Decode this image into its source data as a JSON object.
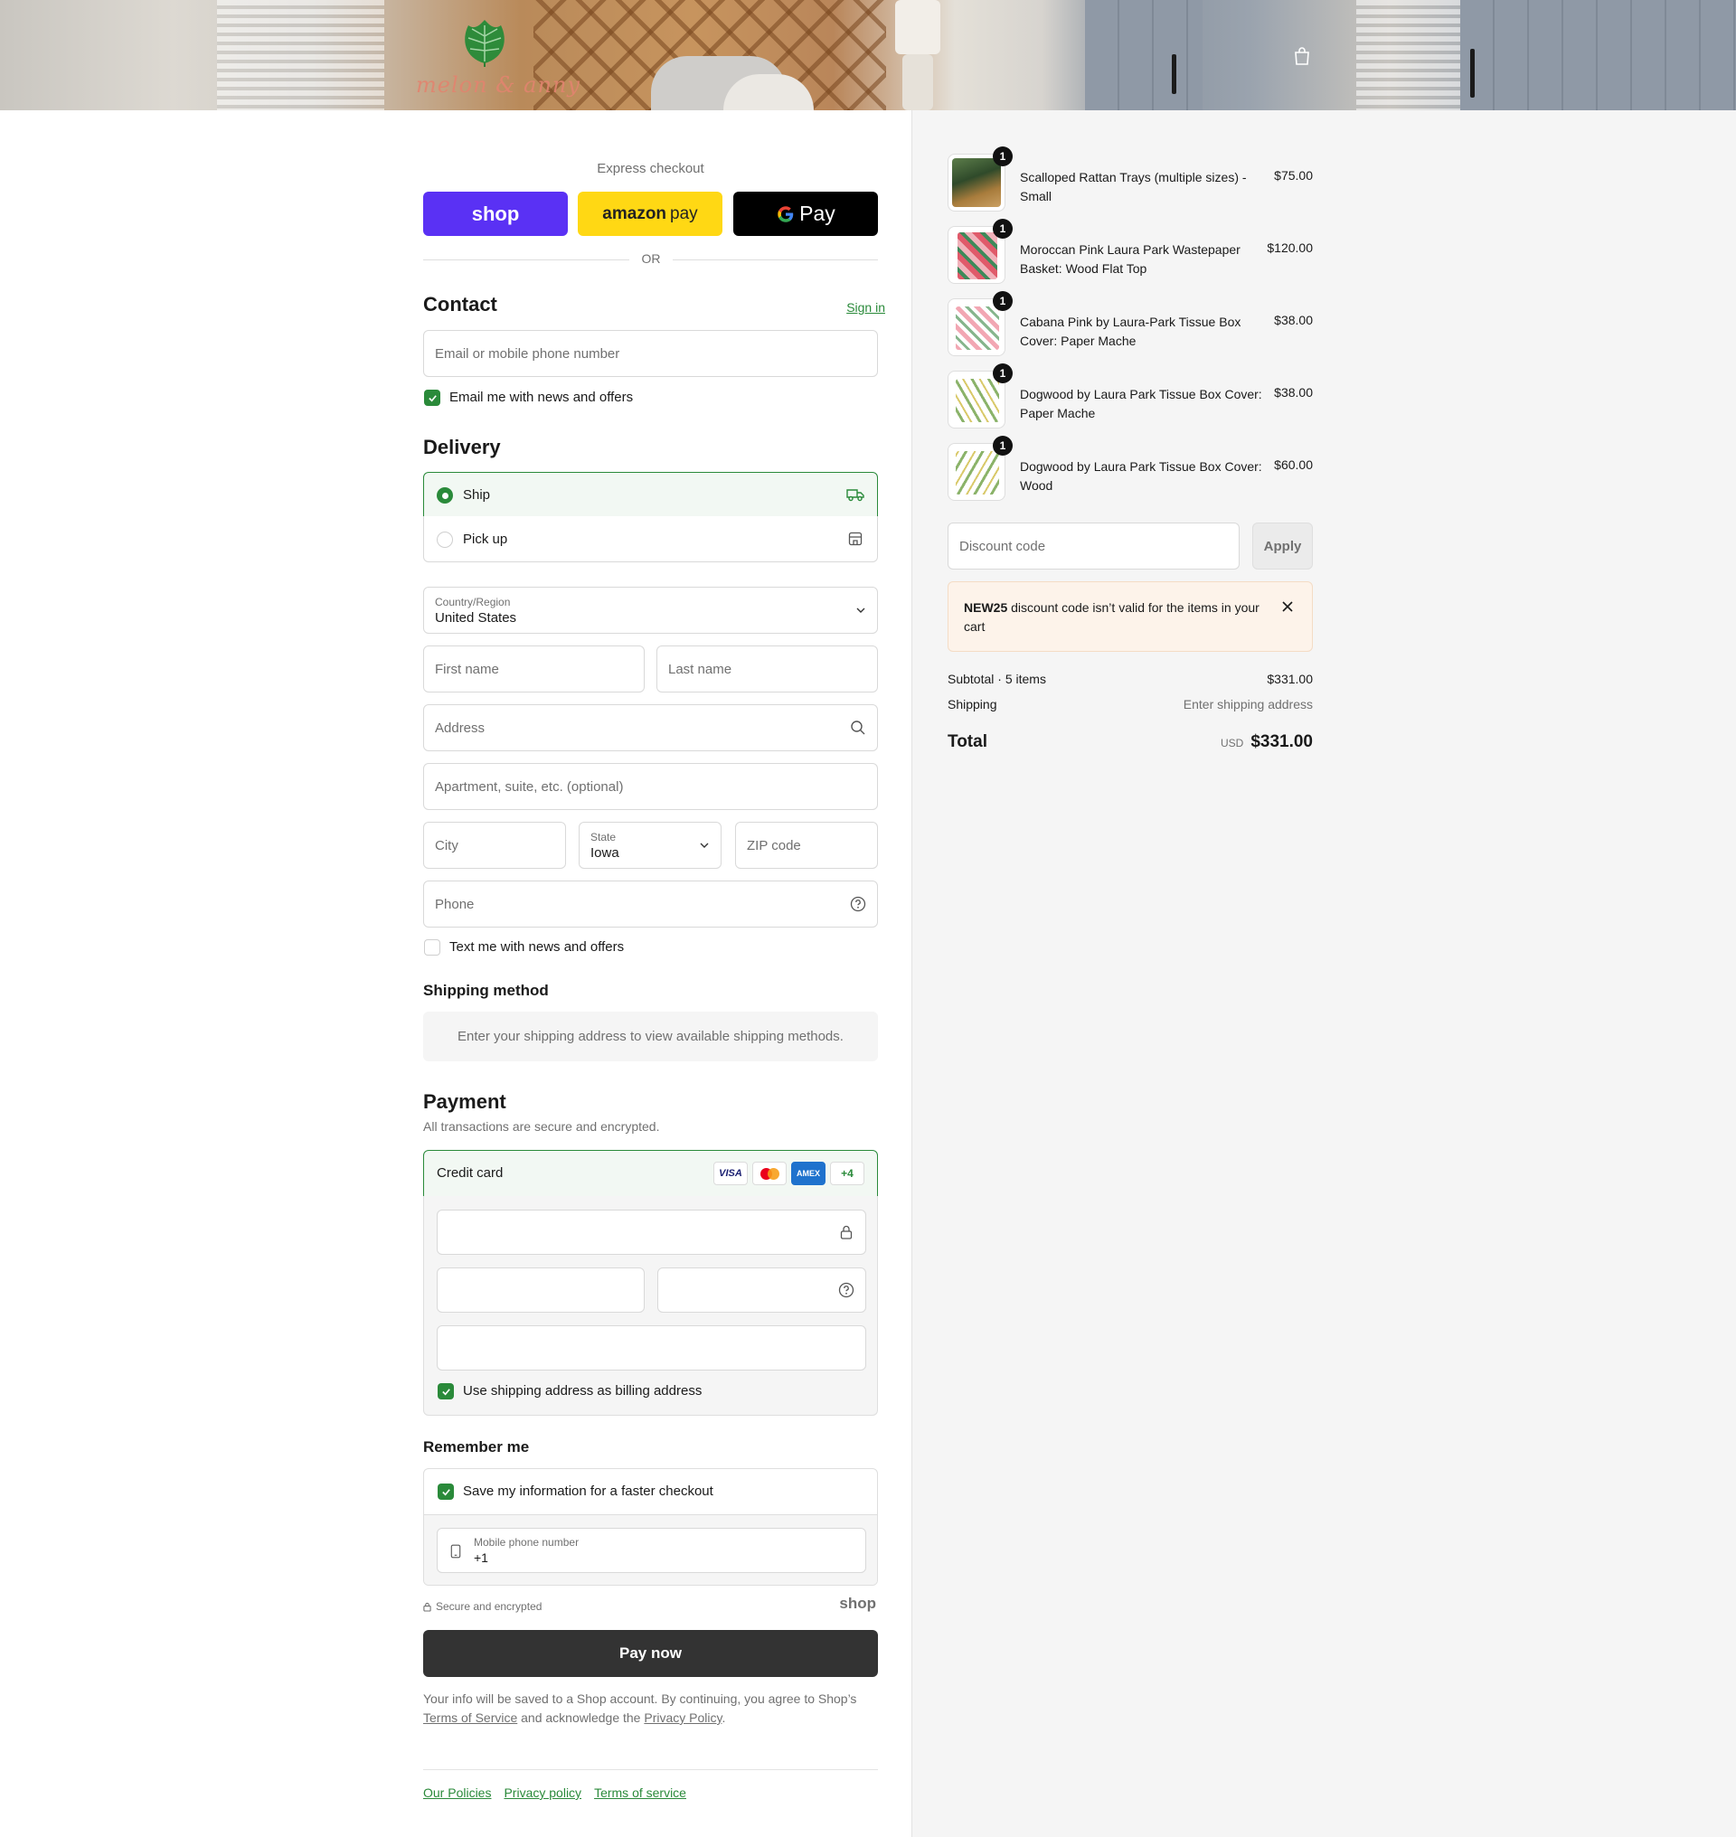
{
  "header": {
    "logo_text": "melon & anny",
    "cart_icon": "shopping-bag-icon"
  },
  "express": {
    "title": "Express checkout",
    "shop_label": "shop",
    "amazon_label_1": "amazon",
    "amazon_label_2": "pay",
    "gpay_label": "Pay",
    "or": "OR"
  },
  "contact": {
    "title": "Contact",
    "sign_in": "Sign in",
    "email_placeholder": "Email or mobile phone number",
    "news_label": "Email me with news and offers",
    "news_checked": true
  },
  "delivery": {
    "title": "Delivery",
    "options": [
      {
        "label": "Ship",
        "selected": true,
        "icon": "truck-icon"
      },
      {
        "label": "Pick up",
        "selected": false,
        "icon": "store-icon"
      }
    ],
    "country_label": "Country/Region",
    "country_value": "United States",
    "first_name": "First name",
    "last_name": "Last name",
    "address": "Address",
    "apartment": "Apartment, suite, etc. (optional)",
    "city": "City",
    "state_label": "State",
    "state_value": "Iowa",
    "zip": "ZIP code",
    "phone": "Phone",
    "text_label": "Text me with news and offers",
    "text_checked": false
  },
  "shipping_method": {
    "title": "Shipping method",
    "message": "Enter your shipping address to view available shipping methods."
  },
  "payment": {
    "title": "Payment",
    "subtitle": "All transactions are secure and encrypted.",
    "method_label": "Credit card",
    "cards": [
      "VISA",
      "mastercard",
      "AMEX",
      "+4"
    ],
    "billing_label": "Use shipping address as billing address",
    "billing_checked": true
  },
  "remember": {
    "title": "Remember me",
    "save_label": "Save my information for a faster checkout",
    "save_checked": true,
    "mobile_label": "Mobile phone number",
    "mobile_value": "+1",
    "secure": "Secure and encrypted",
    "shop_brand": "shop"
  },
  "pay_button": "Pay now",
  "legal": {
    "text_1": "Your info will be saved to a Shop account. By continuing, you agree to Shop’s",
    "terms": "Terms of Service",
    "text_2": "and acknowledge the",
    "privacy": "Privacy Policy",
    "text_3": "."
  },
  "footer_links": [
    "Our Policies",
    "Privacy policy",
    "Terms of service"
  ],
  "summary": {
    "items": [
      {
        "name": "Scalloped Rattan Trays (multiple sizes) - Small",
        "price": "$75.00",
        "qty": "1"
      },
      {
        "name": "Moroccan Pink Laura Park Wastepaper Basket: Wood Flat Top",
        "price": "$120.00",
        "qty": "1"
      },
      {
        "name": "Cabana Pink by Laura-Park Tissue Box Cover: Paper Mache",
        "price": "$38.00",
        "qty": "1"
      },
      {
        "name": "Dogwood by Laura Park Tissue Box Cover: Paper Mache",
        "price": "$38.00",
        "qty": "1"
      },
      {
        "name": "Dogwood by Laura Park Tissue Box Cover: Wood",
        "price": "$60.00",
        "qty": "1"
      }
    ],
    "discount_placeholder": "Discount code",
    "apply": "Apply",
    "warning_code": "NEW25",
    "warning_text": "discount code isn’t valid for the items in your cart",
    "subtotal_label": "Subtotal · 5 items",
    "subtotal_value": "$331.00",
    "shipping_label": "Shipping",
    "shipping_value": "Enter shipping address",
    "total_label": "Total",
    "currency": "USD",
    "total_value": "$331.00"
  },
  "colors": {
    "accent": "#2a8a3a",
    "shop_purple": "#5a31f4",
    "amazon_yellow": "#ffd814",
    "pay_button": "#333333"
  }
}
